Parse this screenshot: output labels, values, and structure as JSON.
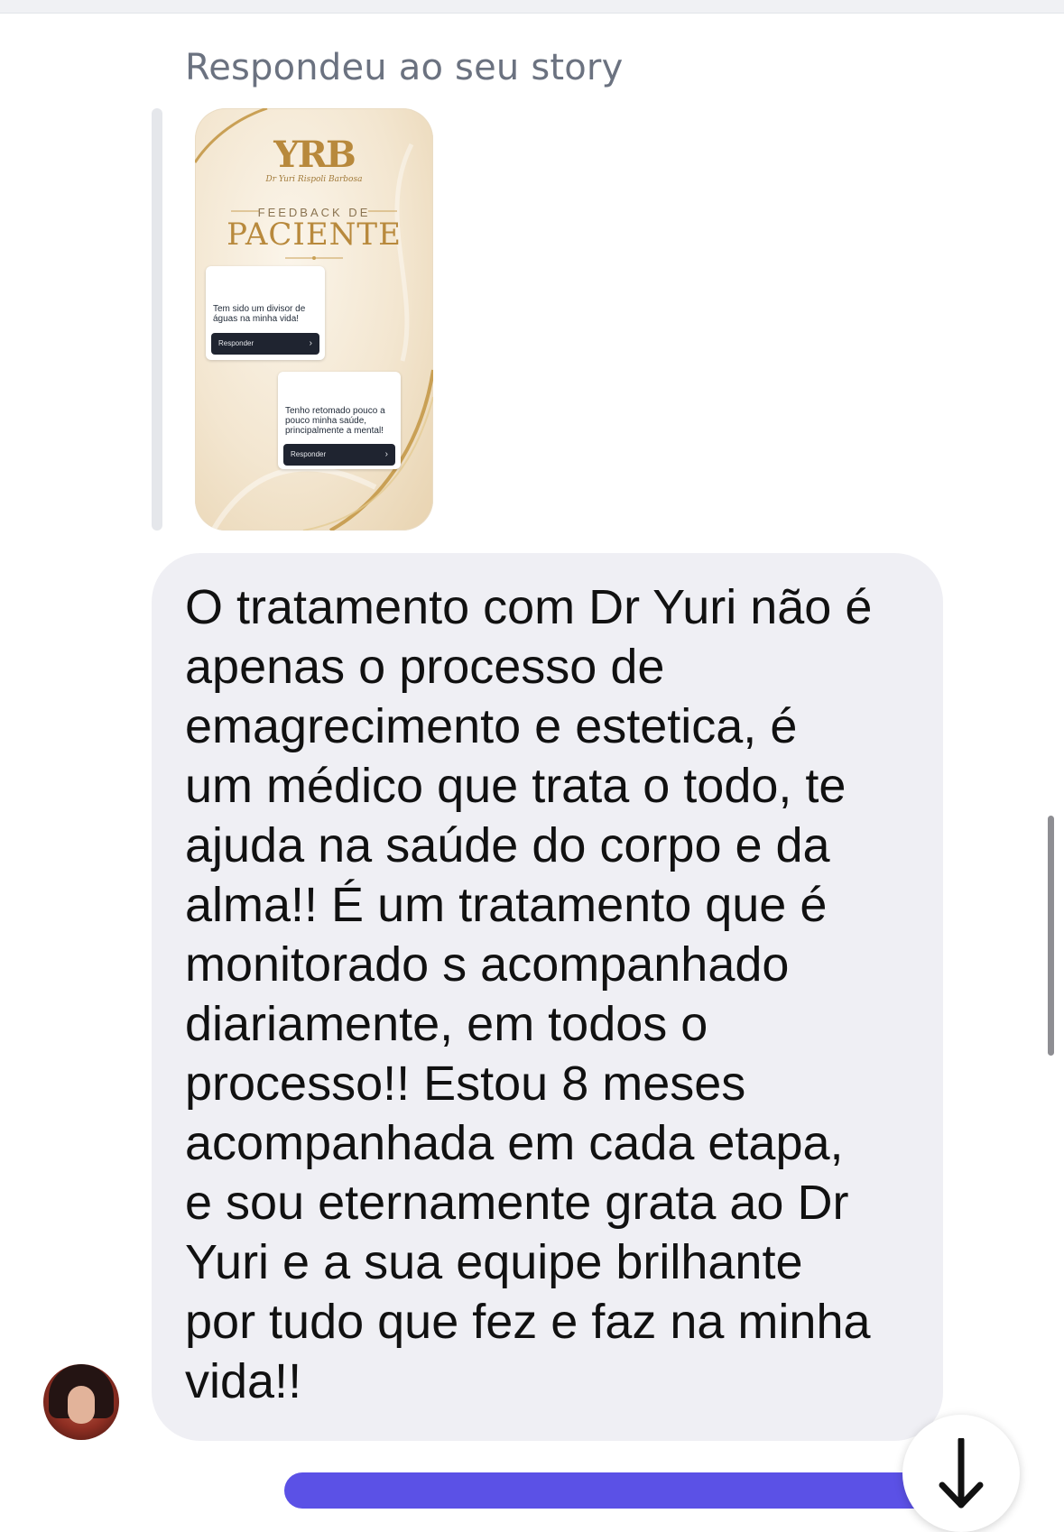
{
  "reply_label": "Respondeu ao seu story",
  "story": {
    "logo": "YRB",
    "logo_subtitle": "Dr Yuri Rispoli Barbosa",
    "heading_small": "FEEDBACK DE",
    "heading_large": "PACIENTE",
    "cards": [
      {
        "text": "Tem sido um divisor de águas na minha vida!",
        "button": "Responder"
      },
      {
        "text": "Tenho retomado pouco a pouco minha saúde, principalmente a mental!",
        "button": "Responder"
      }
    ]
  },
  "message": {
    "text": "O tratamento com Dr Yuri não é\napenas o processo de\nemagrecimento e estetica, é\num médico que trata o todo, te\najuda na saúde do corpo e da\nalma!! É um tratamento que é\nmonitorado s acompanhado\ndiariamente, em todos o\nprocesso!! Estou 8 meses\nacompanhada em cada etapa,\ne sou eternamente grata ao Dr\nYuri e a sua equipe brilhante\npor tudo que fez e faz na minha\nvida!!"
  },
  "icons": {
    "scroll_down": "arrow-down-icon",
    "chevron": "chevron-right-icon"
  },
  "colors": {
    "bubble": "#efeff4",
    "accent": "#5b51e6",
    "gold": "#b8893c",
    "label": "#6b7280"
  }
}
